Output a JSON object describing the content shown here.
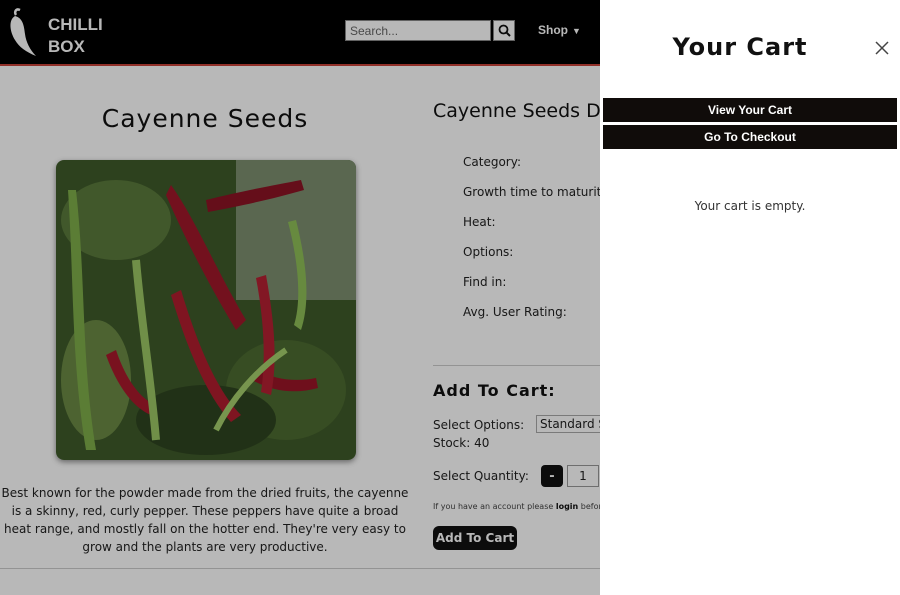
{
  "header": {
    "logo_text_line1": "CHILLI",
    "logo_text_line2": "BOX",
    "search_placeholder": "Search...",
    "search_icon": "search-icon",
    "shop_label": "Shop",
    "shop_caret_icon": "caret-down-icon",
    "colors": {
      "background": "#000000",
      "accent_border": "#c9433a"
    }
  },
  "product": {
    "title": "Cayenne Seeds",
    "description": "Best known for the powder made from the dried fruits, the cayenne is a skinny, red, curly pepper. These peppers have quite a broad heat range, and mostly fall on the hotter end. They're very easy to grow and the plants are very productive.",
    "image_subject": "red cayenne peppers on plant"
  },
  "details": {
    "title": "Cayenne Seeds Deta",
    "labels": [
      "Category:",
      "Growth time to maturity:",
      "Heat:",
      "Options:",
      "Find in:",
      "Avg. User Rating:"
    ]
  },
  "add_to_cart": {
    "title": "Add To Cart:",
    "options_label": "Select Options:",
    "options_value": "Standard S",
    "stock_label": "Stock:",
    "stock_value": "40",
    "quantity_label": "Select Quantity:",
    "minus_label": "-",
    "quantity_value": "1",
    "login_note_before": "If you have an account please",
    "login_link": "login",
    "login_note_after": "before",
    "button_label": "Add To Cart"
  },
  "cart": {
    "title": "Your Cart",
    "close_icon": "close-icon",
    "view_cart_label": "View Your Cart",
    "checkout_label": "Go To Checkout",
    "empty_message": "Your cart is empty.",
    "button_color": "#100c0a"
  }
}
